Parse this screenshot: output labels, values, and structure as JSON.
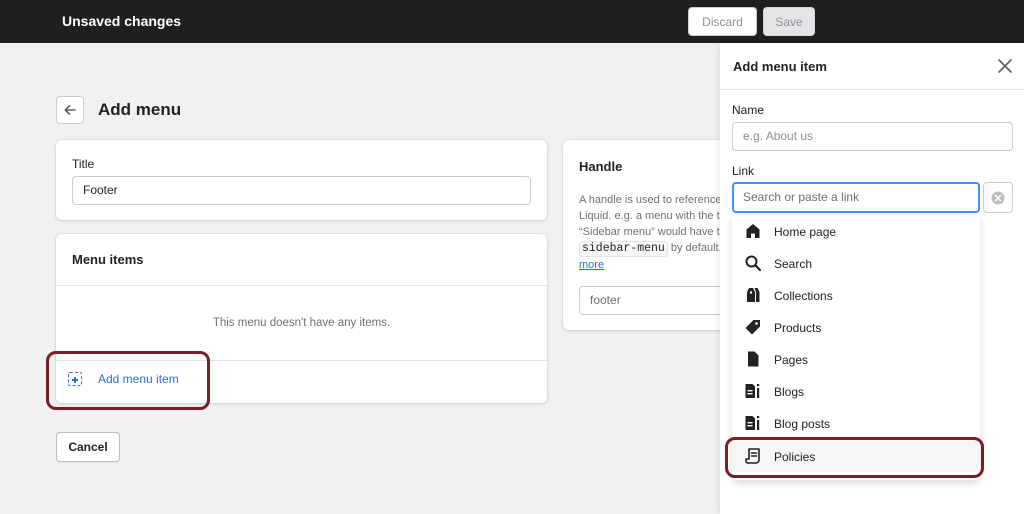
{
  "topbar": {
    "title": "Unsaved changes",
    "discard_label": "Discard",
    "save_label": "Save"
  },
  "page": {
    "title": "Add menu"
  },
  "title_card": {
    "label": "Title",
    "value": "Footer"
  },
  "menu_items_card": {
    "heading": "Menu items",
    "empty_text": "This menu doesn't have any items.",
    "add_label": "Add menu item"
  },
  "cancel_label": "Cancel",
  "handle_card": {
    "heading": "Handle",
    "desc_line1": "A handle is used to reference a menu in",
    "desc_line2": "Liquid. e.g. a menu with the title",
    "desc_line3": "“Sidebar menu” would have the handle",
    "code": "sidebar-menu",
    "desc_after_code": " by default.",
    "more": "more",
    "value": "footer"
  },
  "panel": {
    "title": "Add menu item",
    "name_label": "Name",
    "name_placeholder": "e.g. About us",
    "link_label": "Link",
    "link_placeholder": "Search or paste a link",
    "options": [
      {
        "label": "Home page",
        "icon": "home-icon"
      },
      {
        "label": "Search",
        "icon": "search-icon"
      },
      {
        "label": "Collections",
        "icon": "collections-icon"
      },
      {
        "label": "Products",
        "icon": "tag-icon"
      },
      {
        "label": "Pages",
        "icon": "page-icon"
      },
      {
        "label": "Blogs",
        "icon": "blog-icon"
      },
      {
        "label": "Blog posts",
        "icon": "blog-post-icon"
      },
      {
        "label": "Policies",
        "icon": "policy-scroll-icon"
      }
    ]
  },
  "colors": {
    "topbar": "#1f1f1f",
    "accent_link": "#2c6ecb",
    "focus_border": "#458fff",
    "highlight_annotation": "#7a1d24"
  }
}
